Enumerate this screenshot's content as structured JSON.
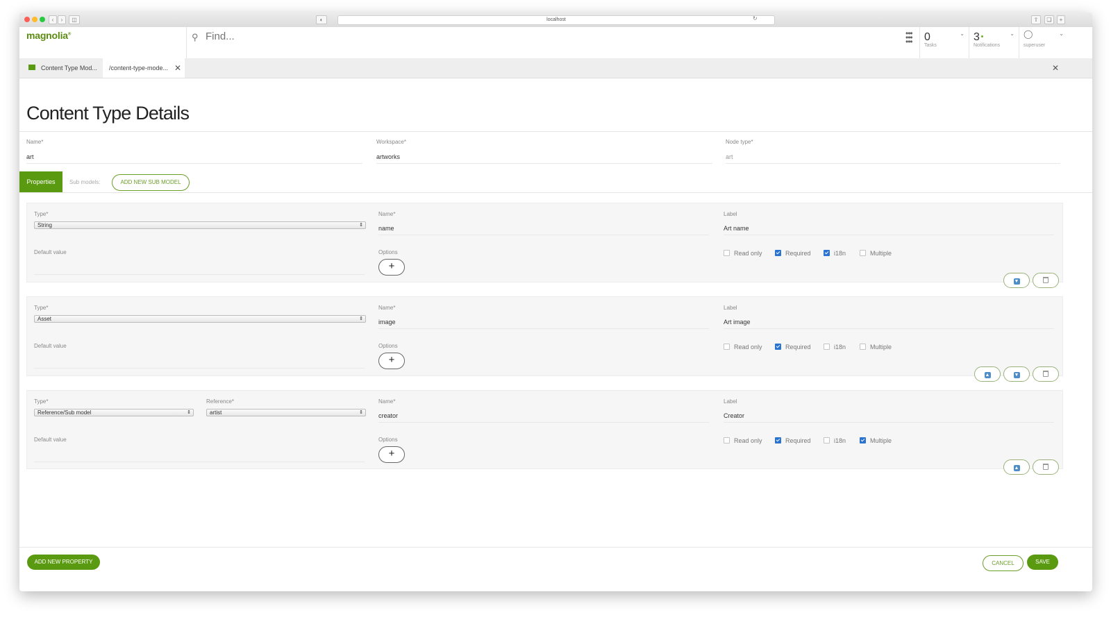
{
  "browser": {
    "url": "localhost"
  },
  "header": {
    "logo": "magnolia",
    "search_placeholder": "Find...",
    "tasks": {
      "count": "0",
      "label": "Tasks"
    },
    "notifications": {
      "count": "3",
      "label": "Notifications"
    },
    "user": {
      "label": "superuser"
    }
  },
  "tabs": [
    {
      "label": "Content Type Mod..."
    },
    {
      "label": "/content-type-mode..."
    }
  ],
  "page": {
    "title": "Content Type Details"
  },
  "fields": {
    "name": {
      "label": "Name*",
      "value": "art"
    },
    "workspace": {
      "label": "Workspace*",
      "value": "artworks"
    },
    "node_type": {
      "label": "Node type*",
      "value": "art"
    }
  },
  "subtabs": {
    "properties": "Properties",
    "sub_models": "Sub models:",
    "add_sub_model": "ADD NEW SUB MODEL"
  },
  "properties": [
    {
      "type_label": "Type*",
      "type": "String",
      "name_label": "Name*",
      "name": "name",
      "label_label": "Label",
      "label": "Art name",
      "default_label": "Default value",
      "options_label": "Options",
      "checkboxes": [
        {
          "label": "Read only",
          "checked": false
        },
        {
          "label": "Required",
          "checked": true
        },
        {
          "label": "i18n",
          "checked": true
        },
        {
          "label": "Multiple",
          "checked": false
        }
      ]
    },
    {
      "type_label": "Type*",
      "type": "Asset",
      "name_label": "Name*",
      "name": "image",
      "label_label": "Label",
      "label": "Art image",
      "default_label": "Default value",
      "options_label": "Options",
      "checkboxes": [
        {
          "label": "Read only",
          "checked": false
        },
        {
          "label": "Required",
          "checked": true
        },
        {
          "label": "i18n",
          "checked": false
        },
        {
          "label": "Multiple",
          "checked": false
        }
      ]
    },
    {
      "type_label": "Type*",
      "type": "Reference/Sub model",
      "reference_label": "Reference*",
      "reference": "artist",
      "name_label": "Name*",
      "name": "creator",
      "label_label": "Label",
      "label": "Creator",
      "default_label": "Default value",
      "options_label": "Options",
      "checkboxes": [
        {
          "label": "Read only",
          "checked": false
        },
        {
          "label": "Required",
          "checked": true
        },
        {
          "label": "i18n",
          "checked": false
        },
        {
          "label": "Multiple",
          "checked": true
        }
      ]
    }
  ],
  "footer": {
    "add_property": "ADD NEW PROPERTY",
    "cancel": "CANCEL",
    "save": "SAVE"
  },
  "colors": {
    "brand_green": "#5a9a10",
    "checkbox_blue": "#2b73d1"
  }
}
